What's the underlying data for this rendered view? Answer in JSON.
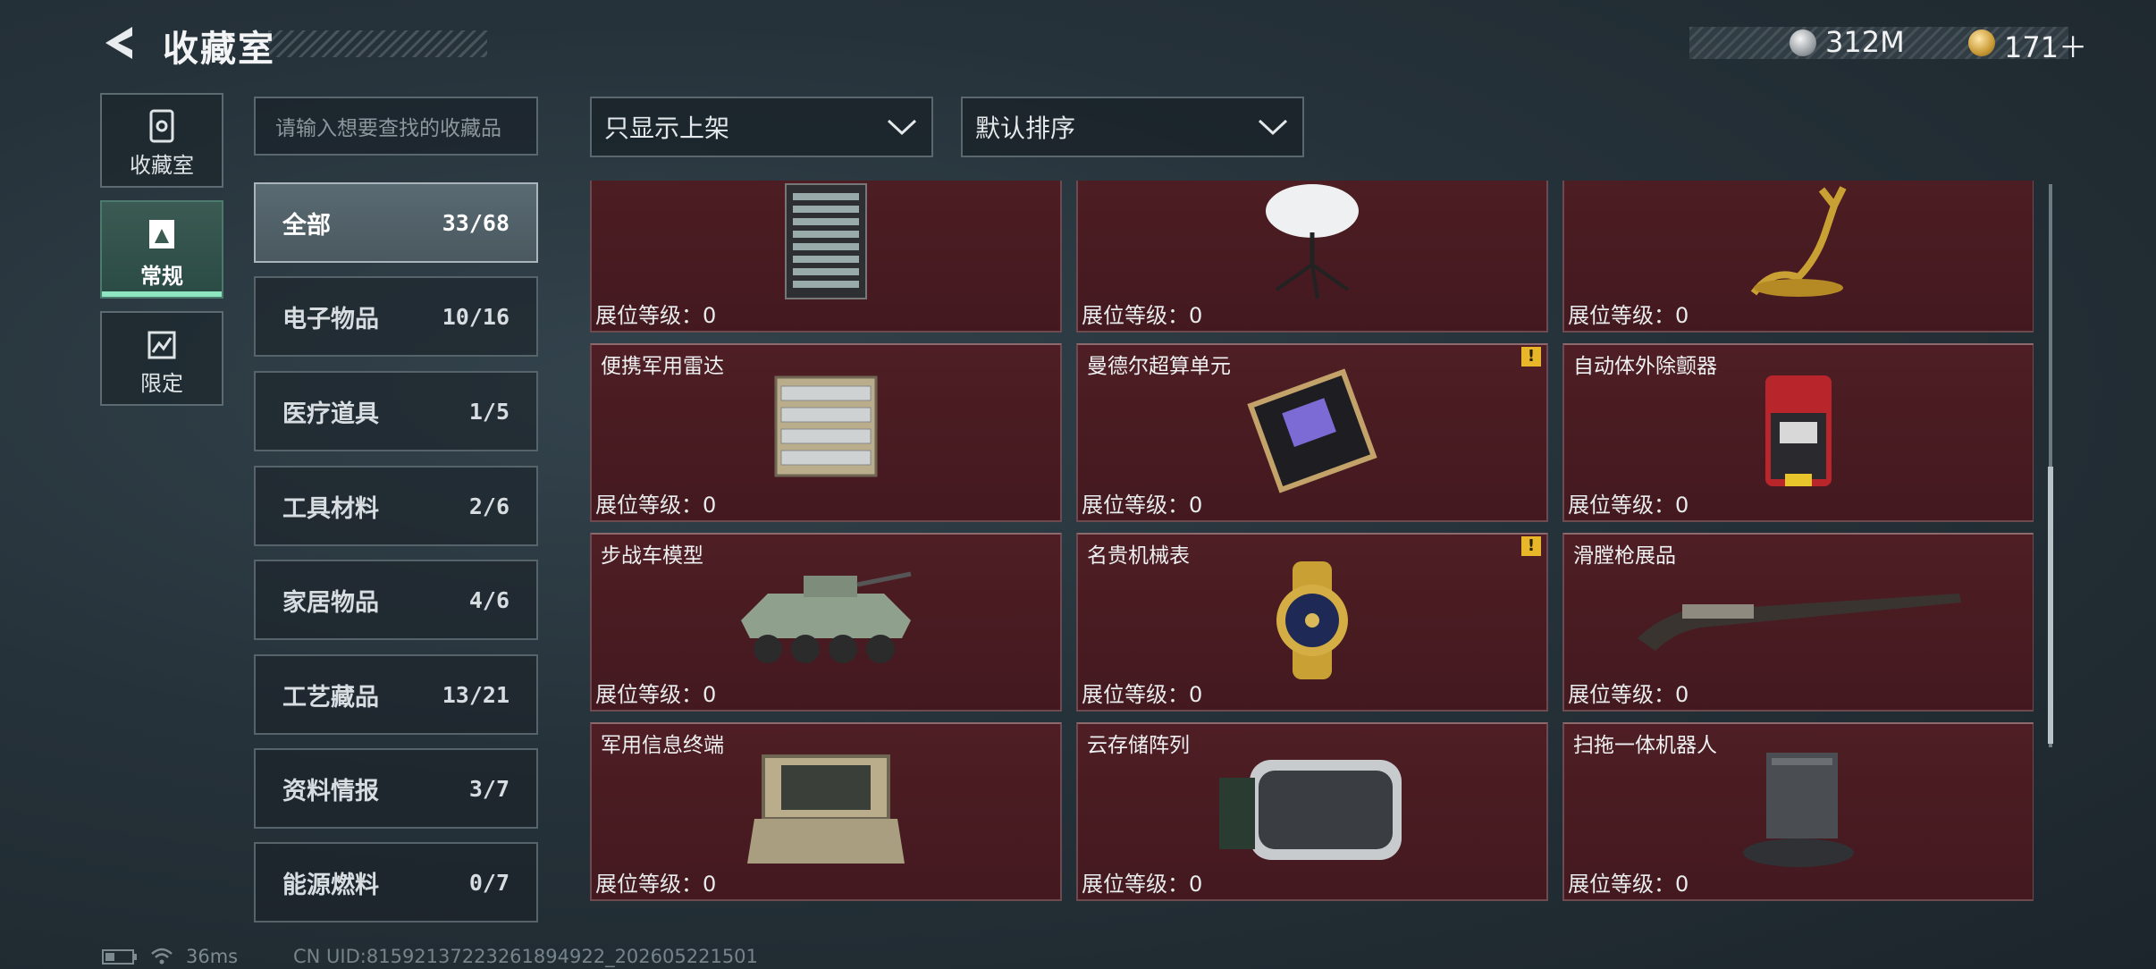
{
  "header": {
    "title": "收藏室",
    "currency": [
      {
        "name": "silver-coin-icon",
        "value": "312M"
      },
      {
        "name": "gold-coin-icon",
        "value": "171＋"
      }
    ]
  },
  "side_nav": [
    {
      "label": "收藏室",
      "icon": "collection-room-icon"
    },
    {
      "label": "常规",
      "icon": "regular-icon",
      "active": true
    },
    {
      "label": "限定",
      "icon": "limited-icon"
    }
  ],
  "search": {
    "placeholder": "请输入想要查找的收藏品"
  },
  "categories": [
    {
      "label": "全部",
      "count": "33/68",
      "active": true
    },
    {
      "label": "电子物品",
      "count": "10/16"
    },
    {
      "label": "医疗道具",
      "count": "1/5"
    },
    {
      "label": "工具材料",
      "count": "2/6"
    },
    {
      "label": "家居物品",
      "count": "4/6"
    },
    {
      "label": "工艺藏品",
      "count": "13/21"
    },
    {
      "label": "资料情报",
      "count": "3/7"
    },
    {
      "label": "能源燃料",
      "count": "0/7"
    }
  ],
  "filters": {
    "display": "只显示上架",
    "sort": "默认排序"
  },
  "grid": {
    "level_label": "展位等级：0",
    "items": [
      {
        "name": "",
        "art": "server-rack",
        "warn": false
      },
      {
        "name": "",
        "art": "satellite-dish",
        "warn": false
      },
      {
        "name": "",
        "art": "golden-deer",
        "warn": false
      },
      {
        "name": "便携军用雷达",
        "art": "portable-radar",
        "warn": false
      },
      {
        "name": "曼德尔超算单元",
        "art": "compute-unit",
        "warn": true
      },
      {
        "name": "自动体外除颤器",
        "art": "defibrillator",
        "warn": false
      },
      {
        "name": "步战车模型",
        "art": "ifv-model",
        "warn": false
      },
      {
        "name": "名贵机械表",
        "art": "mechanical-watch",
        "warn": true
      },
      {
        "name": "滑膛枪展品",
        "art": "musket",
        "warn": false
      },
      {
        "name": "军用信息终端",
        "art": "military-terminal",
        "warn": false
      },
      {
        "name": "云存储阵列",
        "art": "cloud-storage",
        "warn": false
      },
      {
        "name": "扫拖一体机器人",
        "art": "mop-robot",
        "warn": false
      }
    ],
    "warn_symbol": "!"
  },
  "status": {
    "ping": "36ms",
    "uid": "CN UID:8159213722326189492​2_202605221501"
  }
}
